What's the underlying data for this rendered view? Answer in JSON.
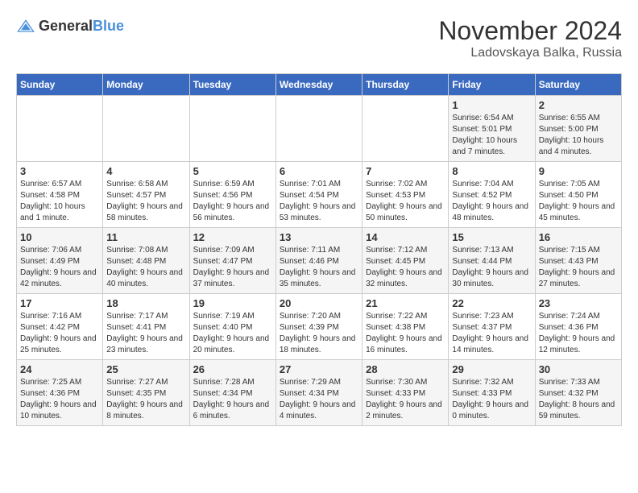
{
  "header": {
    "logo_general": "General",
    "logo_blue": "Blue",
    "month": "November 2024",
    "location": "Ladovskaya Balka, Russia"
  },
  "days_of_week": [
    "Sunday",
    "Monday",
    "Tuesday",
    "Wednesday",
    "Thursday",
    "Friday",
    "Saturday"
  ],
  "weeks": [
    [
      {
        "day": "",
        "info": ""
      },
      {
        "day": "",
        "info": ""
      },
      {
        "day": "",
        "info": ""
      },
      {
        "day": "",
        "info": ""
      },
      {
        "day": "",
        "info": ""
      },
      {
        "day": "1",
        "info": "Sunrise: 6:54 AM\nSunset: 5:01 PM\nDaylight: 10 hours and 7 minutes."
      },
      {
        "day": "2",
        "info": "Sunrise: 6:55 AM\nSunset: 5:00 PM\nDaylight: 10 hours and 4 minutes."
      }
    ],
    [
      {
        "day": "3",
        "info": "Sunrise: 6:57 AM\nSunset: 4:58 PM\nDaylight: 10 hours and 1 minute."
      },
      {
        "day": "4",
        "info": "Sunrise: 6:58 AM\nSunset: 4:57 PM\nDaylight: 9 hours and 58 minutes."
      },
      {
        "day": "5",
        "info": "Sunrise: 6:59 AM\nSunset: 4:56 PM\nDaylight: 9 hours and 56 minutes."
      },
      {
        "day": "6",
        "info": "Sunrise: 7:01 AM\nSunset: 4:54 PM\nDaylight: 9 hours and 53 minutes."
      },
      {
        "day": "7",
        "info": "Sunrise: 7:02 AM\nSunset: 4:53 PM\nDaylight: 9 hours and 50 minutes."
      },
      {
        "day": "8",
        "info": "Sunrise: 7:04 AM\nSunset: 4:52 PM\nDaylight: 9 hours and 48 minutes."
      },
      {
        "day": "9",
        "info": "Sunrise: 7:05 AM\nSunset: 4:50 PM\nDaylight: 9 hours and 45 minutes."
      }
    ],
    [
      {
        "day": "10",
        "info": "Sunrise: 7:06 AM\nSunset: 4:49 PM\nDaylight: 9 hours and 42 minutes."
      },
      {
        "day": "11",
        "info": "Sunrise: 7:08 AM\nSunset: 4:48 PM\nDaylight: 9 hours and 40 minutes."
      },
      {
        "day": "12",
        "info": "Sunrise: 7:09 AM\nSunset: 4:47 PM\nDaylight: 9 hours and 37 minutes."
      },
      {
        "day": "13",
        "info": "Sunrise: 7:11 AM\nSunset: 4:46 PM\nDaylight: 9 hours and 35 minutes."
      },
      {
        "day": "14",
        "info": "Sunrise: 7:12 AM\nSunset: 4:45 PM\nDaylight: 9 hours and 32 minutes."
      },
      {
        "day": "15",
        "info": "Sunrise: 7:13 AM\nSunset: 4:44 PM\nDaylight: 9 hours and 30 minutes."
      },
      {
        "day": "16",
        "info": "Sunrise: 7:15 AM\nSunset: 4:43 PM\nDaylight: 9 hours and 27 minutes."
      }
    ],
    [
      {
        "day": "17",
        "info": "Sunrise: 7:16 AM\nSunset: 4:42 PM\nDaylight: 9 hours and 25 minutes."
      },
      {
        "day": "18",
        "info": "Sunrise: 7:17 AM\nSunset: 4:41 PM\nDaylight: 9 hours and 23 minutes."
      },
      {
        "day": "19",
        "info": "Sunrise: 7:19 AM\nSunset: 4:40 PM\nDaylight: 9 hours and 20 minutes."
      },
      {
        "day": "20",
        "info": "Sunrise: 7:20 AM\nSunset: 4:39 PM\nDaylight: 9 hours and 18 minutes."
      },
      {
        "day": "21",
        "info": "Sunrise: 7:22 AM\nSunset: 4:38 PM\nDaylight: 9 hours and 16 minutes."
      },
      {
        "day": "22",
        "info": "Sunrise: 7:23 AM\nSunset: 4:37 PM\nDaylight: 9 hours and 14 minutes."
      },
      {
        "day": "23",
        "info": "Sunrise: 7:24 AM\nSunset: 4:36 PM\nDaylight: 9 hours and 12 minutes."
      }
    ],
    [
      {
        "day": "24",
        "info": "Sunrise: 7:25 AM\nSunset: 4:36 PM\nDaylight: 9 hours and 10 minutes."
      },
      {
        "day": "25",
        "info": "Sunrise: 7:27 AM\nSunset: 4:35 PM\nDaylight: 9 hours and 8 minutes."
      },
      {
        "day": "26",
        "info": "Sunrise: 7:28 AM\nSunset: 4:34 PM\nDaylight: 9 hours and 6 minutes."
      },
      {
        "day": "27",
        "info": "Sunrise: 7:29 AM\nSunset: 4:34 PM\nDaylight: 9 hours and 4 minutes."
      },
      {
        "day": "28",
        "info": "Sunrise: 7:30 AM\nSunset: 4:33 PM\nDaylight: 9 hours and 2 minutes."
      },
      {
        "day": "29",
        "info": "Sunrise: 7:32 AM\nSunset: 4:33 PM\nDaylight: 9 hours and 0 minutes."
      },
      {
        "day": "30",
        "info": "Sunrise: 7:33 AM\nSunset: 4:32 PM\nDaylight: 8 hours and 59 minutes."
      }
    ]
  ]
}
